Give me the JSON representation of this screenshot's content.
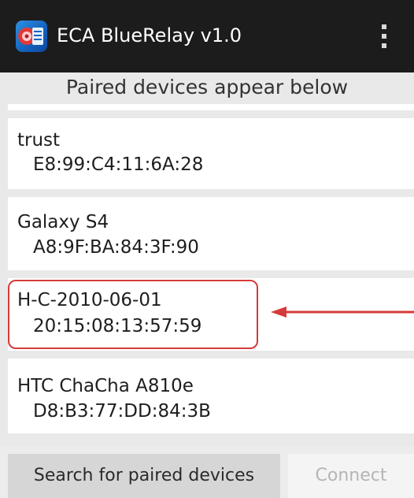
{
  "app_bar": {
    "title": "ECA BlueRelay v1.0",
    "icon": "app-logo-icon",
    "overflow_icon": "overflow-menu-icon",
    "background": "#1c1c1c"
  },
  "header": {
    "text": "Paired devices appear below"
  },
  "devices": [
    {
      "name": "",
      "address": ""
    },
    {
      "name": "trust",
      "address": "E8:99:C4:11:6A:28"
    },
    {
      "name": "Galaxy S4",
      "address": "A8:9F:BA:84:3F:90"
    },
    {
      "name": "H-C-2010-06-01",
      "address": "20:15:08:13:57:59"
    },
    {
      "name": "HTC ChaCha A810e",
      "address": "D8:B3:77:DD:84:3B"
    }
  ],
  "annotation": {
    "highlight_color": "#d53a3a",
    "highlighted_device": "H-C-2010-06-01"
  },
  "buttons": {
    "search_label": "Search for paired devices",
    "connect_label": "Connect"
  }
}
